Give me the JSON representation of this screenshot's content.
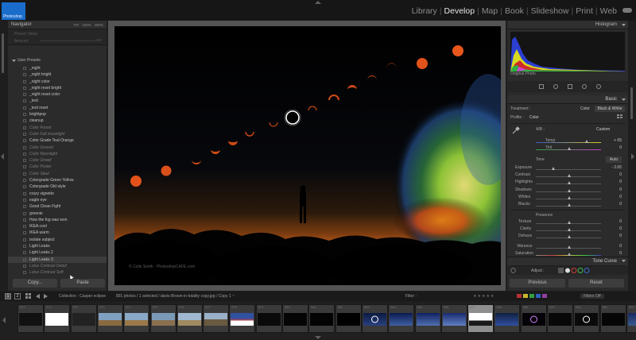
{
  "app": {
    "logo_label": "Photoshop",
    "modules": [
      "Library",
      "Develop",
      "Map",
      "Book",
      "Slideshow",
      "Print",
      "Web"
    ],
    "active_module": "Develop"
  },
  "left_panel": {
    "navigator_title": "Navigator",
    "zoom_options": [
      "FIT",
      "100%",
      "200%"
    ],
    "preset_amount_label": "Preset: None",
    "amount_label": "Amount",
    "amount_value": "100",
    "user_presets_label": "User Presets",
    "presets": [
      {
        "name": "_night",
        "style": "normal"
      },
      {
        "name": "_night bright",
        "style": "normal"
      },
      {
        "name": "_night color",
        "style": "normal"
      },
      {
        "name": "_night reset bright",
        "style": "normal"
      },
      {
        "name": "_night reset color",
        "style": "normal"
      },
      {
        "name": "_test",
        "style": "normal"
      },
      {
        "name": "_test reset",
        "style": "normal"
      },
      {
        "name": "brightpop",
        "style": "normal"
      },
      {
        "name": "cleanup",
        "style": "normal"
      },
      {
        "name": "Color Forest",
        "style": "dim"
      },
      {
        "name": "Color Full moonlight",
        "style": "dim"
      },
      {
        "name": "Color Grade Teal Orange",
        "style": "normal"
      },
      {
        "name": "Color Ground",
        "style": "dim"
      },
      {
        "name": "Color Moonlight",
        "style": "dim"
      },
      {
        "name": "Color Orwell",
        "style": "dim"
      },
      {
        "name": "Color Poster",
        "style": "dim"
      },
      {
        "name": "Color Steel",
        "style": "dim"
      },
      {
        "name": "Colorgrade Green Yellow",
        "style": "normal"
      },
      {
        "name": "Colorgrade Old style",
        "style": "normal"
      },
      {
        "name": "crazy vignette",
        "style": "normal"
      },
      {
        "name": "eagle eye",
        "style": "normal"
      },
      {
        "name": "Good Clean Fight",
        "style": "normal"
      },
      {
        "name": "greenie",
        "style": "normal"
      },
      {
        "name": "How the fog was won",
        "style": "normal"
      },
      {
        "name": "IKEA cool",
        "style": "normal"
      },
      {
        "name": "IKEA warm",
        "style": "normal"
      },
      {
        "name": "isolate subject",
        "style": "normal"
      },
      {
        "name": "Light Leaks",
        "style": "normal"
      },
      {
        "name": "Light Leaks 2",
        "style": "normal"
      },
      {
        "name": "Light Leaks 3",
        "style": "sel"
      },
      {
        "name": "Lotus Contrast Detail",
        "style": "dim"
      },
      {
        "name": "Lotus Contrast Soft",
        "style": "dim"
      }
    ],
    "copy_label": "Copy...",
    "paste_label": "Paste"
  },
  "photo": {
    "watermark": "© Colin Smith · PhotoshopCAFE.com"
  },
  "right_panel": {
    "histogram_title": "Histogram",
    "original_photo_label": "Original Photo",
    "basic_title": "Basic",
    "treatment_label": "Treatment :",
    "color_label": "Color",
    "bw_label": "Black & White",
    "profile_label": "Profile :",
    "profile_value": "Color",
    "wb_label": "WB :",
    "wb_value": "Custom",
    "temp_label": "Temp",
    "temp_value": "+ 65",
    "tint_label": "Tint",
    "tint_value": "0",
    "tone_label": "Tone",
    "auto_label": "Auto",
    "exposure_label": "Exposure",
    "exposure_value": "- 2.65",
    "contrast_label": "Contrast",
    "contrast_value": "0",
    "highlights_label": "Highlights",
    "highlights_value": "0",
    "shadows_label": "Shadows",
    "shadows_value": "0",
    "whites_label": "Whites",
    "whites_value": "0",
    "blacks_label": "Blacks",
    "blacks_value": "0",
    "presence_label": "Presence",
    "texture_label": "Texture",
    "texture_value": "0",
    "clarity_label": "Clarity",
    "clarity_value": "0",
    "dehaze_label": "Dehaze",
    "dehaze_value": "0",
    "vibrance_label": "Vibrance",
    "vibrance_value": "0",
    "saturation_label": "Saturation",
    "saturation_value": "0",
    "adjust_label": "Adjust :",
    "tone_curve_title": "Tone Curve",
    "previous_label": "Previous",
    "reset_label": "Reset"
  },
  "filmstrip": {
    "page1": "1",
    "page2": "2",
    "source_text": "Collection : Casper eclipse",
    "count_text": "891 photos / 1 selected / davis-Brown-in-totality copy.jpg / Copy 1 ~",
    "filter_label": "Filter :",
    "filters_off": "Filters Off",
    "thumb_numbers": [
      "870",
      "871",
      "872",
      "873",
      "874",
      "875",
      "876",
      "877",
      "878",
      "879",
      "880",
      "881",
      "882",
      "883",
      "884",
      "885",
      "886",
      "887",
      "888",
      "889",
      "890",
      "891",
      "892",
      "893"
    ],
    "selected_index": 17
  },
  "colors": {
    "accent": "#1b6dcc",
    "sun_orange": "#e5561c",
    "panel_bg": "#2b2b2b"
  }
}
